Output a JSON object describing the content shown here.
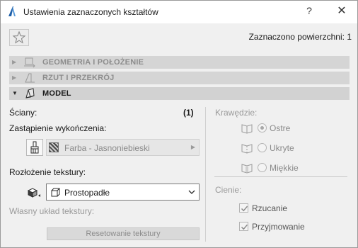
{
  "window": {
    "title": "Ustawienia zaznaczonych kształtów",
    "help_label": "?",
    "close_label": "✕",
    "app_icon": "archicad-logo-icon"
  },
  "header": {
    "favorites_icon": "star-icon",
    "selected_count": "Zaznaczono powierzchni: 1"
  },
  "sections": {
    "geometry": {
      "label": "GEOMETRIA I POŁOŻENIE",
      "expanded": false,
      "icon": "geometry-icon"
    },
    "plan": {
      "label": "RZUT I PRZEKRÓJ",
      "expanded": false,
      "icon": "plan-section-icon"
    },
    "model": {
      "label": "MODEL",
      "expanded": true,
      "icon": "model-icon"
    }
  },
  "model": {
    "faces_label": "Ściany:",
    "faces_count": "(1)",
    "override_label": "Zastąpienie wykończenia:",
    "material_value": "Farba - Jasnoniebieski",
    "texture_mapping_label": "Rozłożenie tekstury:",
    "projection_value": "Prostopadłe",
    "custom_texture_label": "Własny układ tekstury:",
    "reset_texture_label": "Resetowanie tekstury"
  },
  "edges": {
    "label": "Krawędzie:",
    "options": [
      {
        "label": "Ostre",
        "selected": true,
        "icon": "sharp-edge-icon"
      },
      {
        "label": "Ukryte",
        "selected": false,
        "icon": "hidden-edge-icon"
      },
      {
        "label": "Miękkie",
        "selected": false,
        "icon": "soft-edge-icon"
      }
    ]
  },
  "shadows": {
    "label": "Cienie:",
    "options": [
      {
        "label": "Rzucanie",
        "checked": true
      },
      {
        "label": "Przyjmowanie",
        "checked": true
      }
    ]
  },
  "colors": {
    "section_bg": "#d5d5d5",
    "panel_bg": "#f0f0f0",
    "disabled_text": "#9a9a9a"
  }
}
